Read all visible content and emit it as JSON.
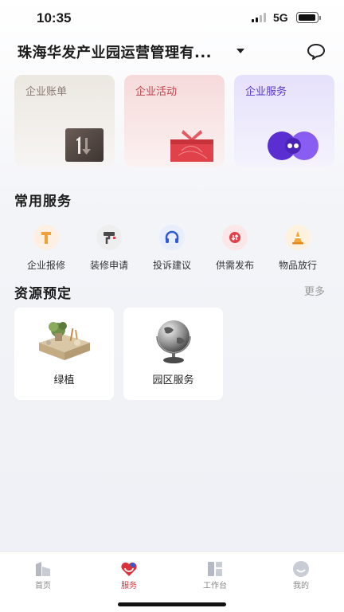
{
  "status": {
    "time": "10:35",
    "network": "5G"
  },
  "header": {
    "org_name": "珠海华发产业园运营管理有..."
  },
  "top_cards": [
    {
      "label": "企业账单",
      "icon": "bill-icon"
    },
    {
      "label": "企业活动",
      "icon": "gift-icon"
    },
    {
      "label": "企业服务",
      "icon": "service-circles-icon"
    }
  ],
  "common_services": {
    "title": "常用服务",
    "items": [
      {
        "label": "企业报修",
        "icon": "repair-icon"
      },
      {
        "label": "装修申请",
        "icon": "paint-roller-icon"
      },
      {
        "label": "投诉建议",
        "icon": "headset-icon"
      },
      {
        "label": "供需发布",
        "icon": "supply-demand-icon"
      },
      {
        "label": "物品放行",
        "icon": "cone-icon"
      }
    ]
  },
  "resources": {
    "title": "资源预定",
    "more": "更多",
    "items": [
      {
        "label": "绿植",
        "icon": "plant-icon"
      },
      {
        "label": "园区服务",
        "icon": "globe-icon"
      }
    ]
  },
  "tabbar": {
    "items": [
      {
        "label": "首页",
        "icon": "home-building-icon"
      },
      {
        "label": "服务",
        "icon": "heart-service-icon",
        "active": true
      },
      {
        "label": "工作台",
        "icon": "dashboard-icon"
      },
      {
        "label": "我的",
        "icon": "profile-icon"
      }
    ]
  },
  "colors": {
    "accent": "#d9323a",
    "bill": "#8a7b70",
    "activity": "#c2424b",
    "service": "#5a36c8"
  }
}
